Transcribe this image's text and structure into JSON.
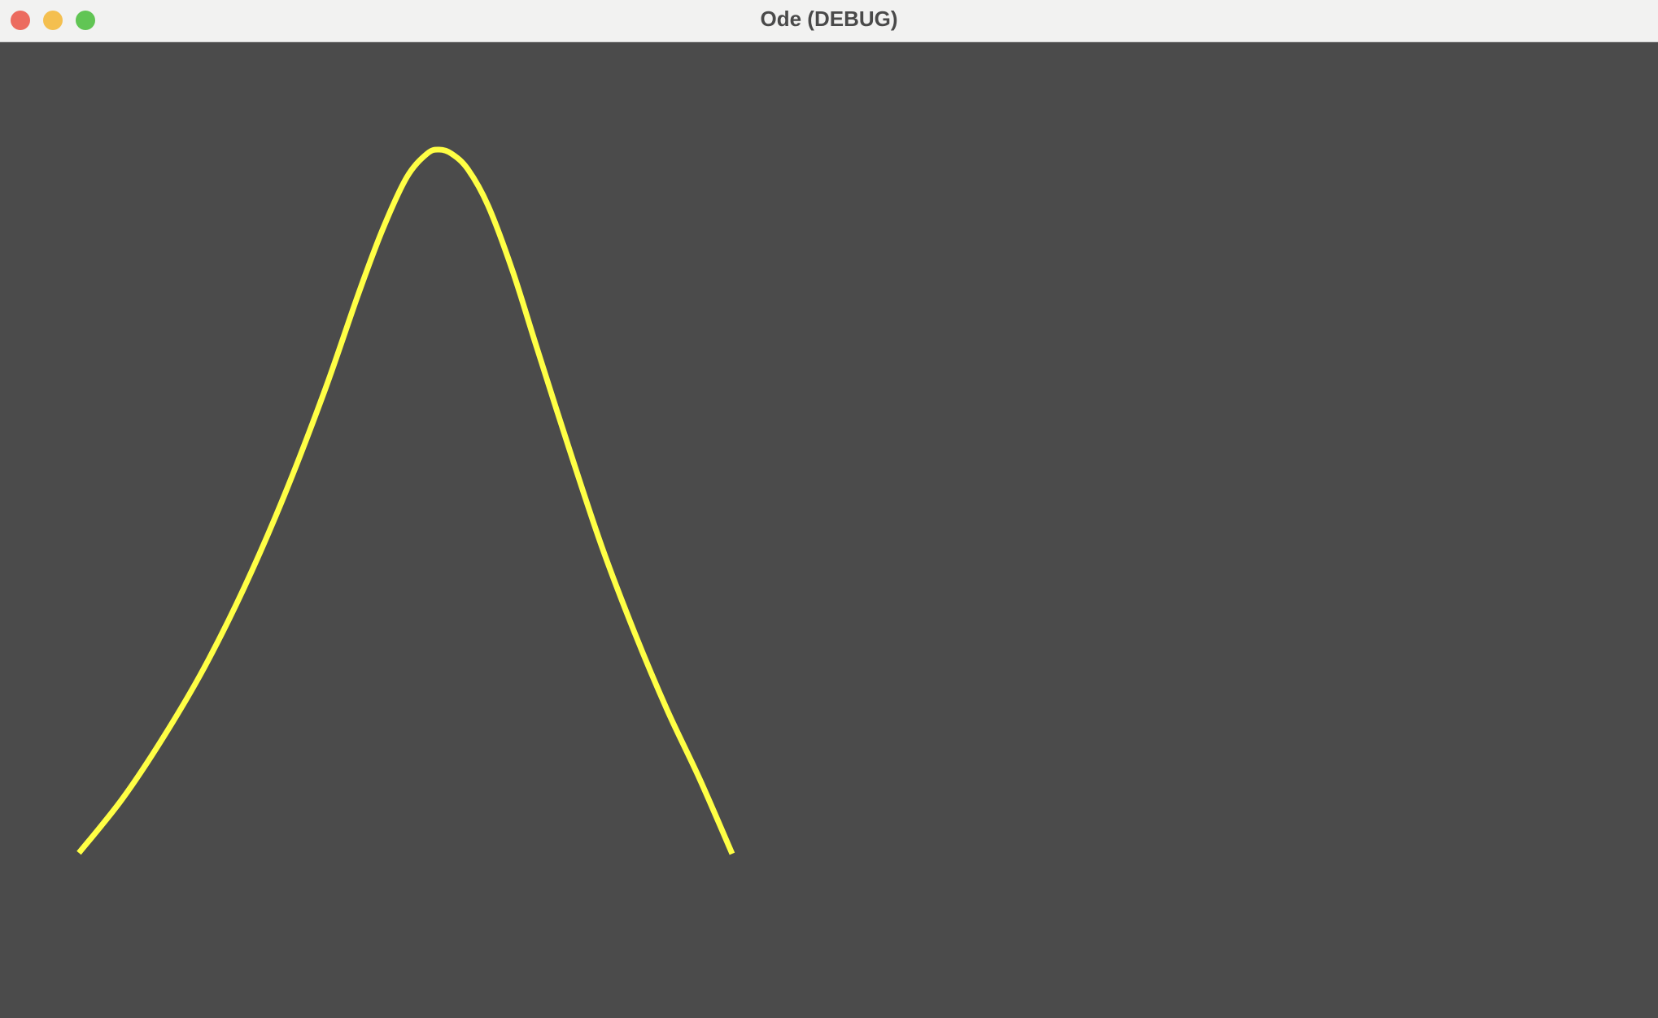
{
  "window": {
    "title": "Ode (DEBUG)",
    "controls": {
      "close_color": "#ec6b5f",
      "minimize_color": "#f4bf4f",
      "maximize_color": "#61c554"
    }
  },
  "canvas": {
    "background_color": "#4b4b4b",
    "curve_color": "#ffff44",
    "curve_shape": "single peak"
  }
}
